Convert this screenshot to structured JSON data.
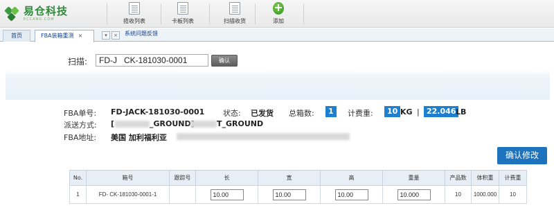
{
  "app": {
    "logo_cn": "易仓科技",
    "logo_en": "ECCANG.COM"
  },
  "toolbar": [
    {
      "label": "揽收列表",
      "icon": "document-list-icon"
    },
    {
      "label": "卡板列表",
      "icon": "document-list-icon"
    },
    {
      "label": "扫描收货",
      "icon": "document-list-icon"
    },
    {
      "label": "添加",
      "icon": "add-green-icon"
    }
  ],
  "tabs": {
    "home": "首页",
    "active": "FBA装箱重测",
    "close": "×",
    "feedback": "系统问题反馈"
  },
  "scan": {
    "label": "扫描:",
    "value": "FD-J   CK-181030-0001",
    "button": "确认"
  },
  "info": {
    "fba_no_label": "FBA单号:",
    "fba_no": "FD-JACK-181030-0001",
    "status_label": "状态:",
    "status": "已发货",
    "box_count_label": "总箱数:",
    "box_count": "1",
    "charge_weight_label": "计费重:",
    "charge_weight_kg": "10",
    "kg_unit": "KG",
    "divider": "|",
    "charge_weight_lb": "22.046",
    "lb_unit": "LB",
    "shipping_label": "派送方式:",
    "shipping_a": "[",
    "shipping_b": "_GROUND]",
    "shipping_c": "T_GROUND",
    "address_label": "FBA地址:",
    "address": "美国 加利福利亚"
  },
  "modify_button": "确认修改",
  "table": {
    "headers": [
      "No.",
      "箱号",
      "跟踪号",
      "长",
      "宽",
      "高",
      "重量",
      "产品数",
      "体积重",
      "计费重"
    ],
    "rows": [
      {
        "no": "1",
        "box_no": "FD-   CK-181030-0001-1",
        "tracking": "",
        "length": "10.00",
        "width": "10.00",
        "height": "10.00",
        "weight": "10.000",
        "products": "10",
        "volume_weight": "1000.000",
        "charge_weight": "10"
      }
    ]
  }
}
